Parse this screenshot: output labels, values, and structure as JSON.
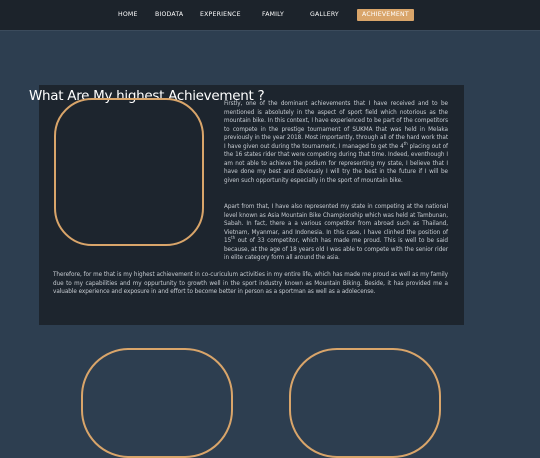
{
  "nav": {
    "items": [
      {
        "label": "HOME"
      },
      {
        "label": "BIODATA"
      },
      {
        "label": "EXPERIENCE"
      },
      {
        "label": "FAMILY"
      },
      {
        "label": "GALLERY"
      },
      {
        "label": "ACHIEVEMENT"
      }
    ],
    "active": "ACHIEVEMENT"
  },
  "section": {
    "title": "What Are My highest Achievement ?",
    "p1_a": "Firstly, one of the dominant achievements that I have received and to be mentioned is absolutely in the aspect of sport field which notorious as the mountain bike. In this context, I have experienced to be part of the competitors to compete in the prestige tournament of SUKMA that was held in Melaka previously in the year 2018. Most importantly, through all of the hard work that I have given out during the tournament, I managed to get the 4",
    "p1_sup": "th",
    "p1_b": " placing out of the 16 states rider that were competing during that time. Indeed, eventhough I am not able to achieve the podium for representing my state, I believe that I have done my best and obviously I will try the best in the future if I will be given such opportunity especially in the sport of mountain bike.",
    "p2_a": "Apart from that, I have also represented my state in competing at the national level known as Asia Mountain Bike Championship which was held at Tambunan, Sabah. In fact, there a a various competitor from abroad such as Thailand, Vietnam, Myanmar, and Indonesia. In this case, I have clinhed the position of 15",
    "p2_sup": "th",
    "p2_b": " out of 33 competitor, which has made me proud. This is well to be said because, at the age of 18 years old I was able to compete with the senior rider in elite category form all around the asia.",
    "p3": "Therefore, for me that is my highest achievement in co-curiculum activities in my entire life, which has made me proud as well as my family due to my capabilities and my oppurtunity to growth well in the sport industry known as Mountain Biking. Beside, it has provided me a valuable experience and exposure in and effort to become better in person as a sportman as well as a adolecense."
  },
  "colors": {
    "accent": "#d9a56a",
    "page_bg": "#2d3e50",
    "topbar_bg": "#1c232b",
    "card_bg": "#1d252e"
  }
}
